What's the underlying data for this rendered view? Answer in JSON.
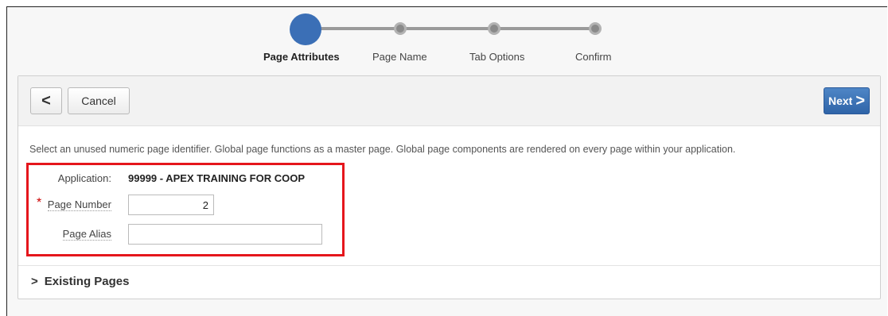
{
  "wizard": {
    "steps": [
      {
        "label": "Page Attributes",
        "active": true
      },
      {
        "label": "Page Name",
        "active": false
      },
      {
        "label": "Tab Options",
        "active": false
      },
      {
        "label": "Confirm",
        "active": false
      }
    ]
  },
  "toolbar": {
    "prev_icon": "<",
    "cancel_label": "Cancel",
    "next_label": "Next",
    "next_icon": ">"
  },
  "help_text": "Select an unused numeric page identifier. Global page functions as a master page. Global page components are rendered on every page within your application.",
  "form": {
    "application_label": "Application:",
    "application_value": "99999 - APEX TRAINING FOR COOP",
    "page_number_label": "Page Number",
    "page_number_required": "*",
    "page_number_value": "2",
    "page_alias_label": "Page Alias",
    "page_alias_value": ""
  },
  "existing_pages": {
    "icon": ">",
    "label": "Existing Pages"
  },
  "colors": {
    "accent": "#3b6fb6",
    "highlight": "#e5161c",
    "required": "#cc0000"
  }
}
